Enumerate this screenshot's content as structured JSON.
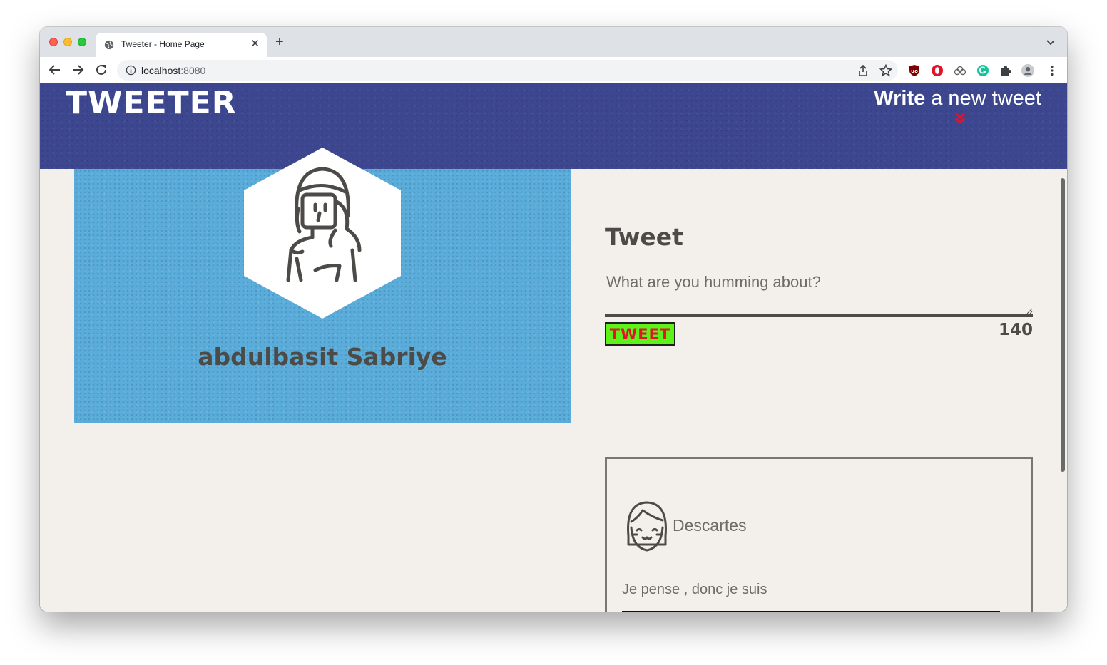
{
  "browser": {
    "tab_title": "Tweeter - Home Page",
    "tab_close": "✕",
    "new_tab": "+",
    "url_host": "localhost",
    "url_port": ":8080"
  },
  "colors": {
    "navbar": "#3c4790",
    "profile_bg": "#5aaddb",
    "page_bg": "#f3f0ec",
    "tweet_button_bg": "#5ef21b",
    "tweet_button_text": "#e3132a",
    "text_dark": "#4d4b47"
  },
  "icons": [
    "globe-icon",
    "chevron-down-icon",
    "back-icon",
    "forward-icon",
    "reload-icon",
    "info-icon",
    "share-icon",
    "star-icon",
    "ublock-icon",
    "opera-icon",
    "extension-cloud-icon",
    "grammarly-icon",
    "puzzle-icon",
    "profile-icon",
    "kebab-menu-icon",
    "double-chevron-down-icon"
  ],
  "header": {
    "brand": "TWEETER",
    "compose_bold": "Write",
    "compose_rest": "a new tweet"
  },
  "profile": {
    "name": "abdulbasit Sabriye"
  },
  "composer": {
    "title": "Tweet",
    "placeholder": "What are you humming about?",
    "button_label": "TWEET",
    "counter": "140"
  },
  "tweets": [
    {
      "author": "Descartes",
      "text": "Je pense , donc je suis"
    }
  ]
}
